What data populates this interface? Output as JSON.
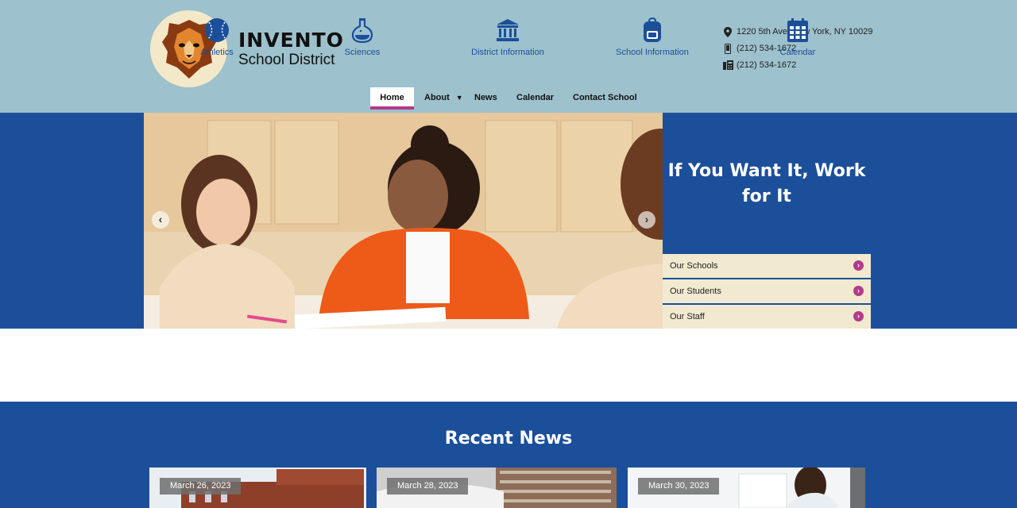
{
  "brand": {
    "title": "INVENTO",
    "subtitle": "School District"
  },
  "contact": {
    "address": "1220 5th Ave, New York, NY 10029",
    "phone": "(212) 534-1672",
    "fax": "(212) 534-1672",
    "icons": [
      "map-pin-icon",
      "mobile-phone-icon",
      "fax-icon"
    ]
  },
  "nav": {
    "items": [
      {
        "label": "Home",
        "active": true
      },
      {
        "label": "About",
        "has_dropdown": true
      },
      {
        "label": "News"
      },
      {
        "label": "Calendar"
      },
      {
        "label": "Contact School"
      }
    ]
  },
  "hero": {
    "heading": "If You Want It, Work for It",
    "quick_links": [
      {
        "label": "Our Schools"
      },
      {
        "label": "Our Students"
      },
      {
        "label": "Our Staff"
      }
    ]
  },
  "quick_icons": [
    {
      "label": "Athletics",
      "icon": "baseball-icon"
    },
    {
      "label": "Sciences",
      "icon": "flask-icon"
    },
    {
      "label": "District Information",
      "icon": "building-columns-icon"
    },
    {
      "label": "School Information",
      "icon": "backpack-icon"
    },
    {
      "label": "Calendar",
      "icon": "calendar-icon"
    }
  ],
  "news": {
    "heading": "Recent News",
    "items": [
      {
        "date": "March 26, 2023"
      },
      {
        "date": "March 28, 2023"
      },
      {
        "date": "March 30, 2023"
      }
    ]
  },
  "colors": {
    "header_bg": "#9dc1cd",
    "primary_blue": "#1c4f9a",
    "accent_magenta": "#b33b8c",
    "quick_link_bg": "#f1ead0"
  }
}
